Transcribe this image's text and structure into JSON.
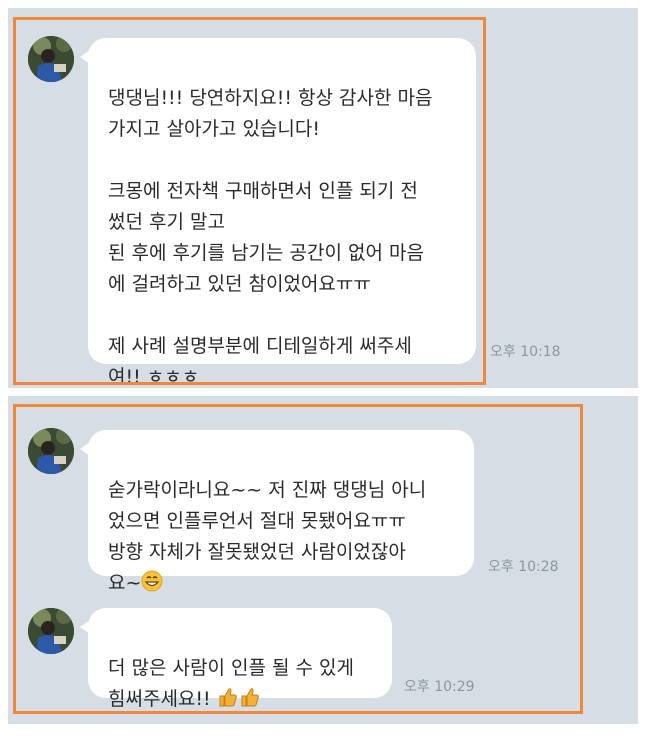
{
  "messages": [
    {
      "text": "댕댕님!!! 당연하지요!! 항상 감사한 마음\n가지고 살아가고 있습니다!\n\n크몽에 전자책 구매하면서 인플 되기 전\n썼던 후기 말고\n된 후에 후기를 남기는 공간이 없어 마음\n에 걸려하고 있던 참이었어요ㅠㅠ\n\n제 사례 설명부분에 디테일하게 써주세\n여!! ㅎㅎㅎ",
      "time": "오후 10:18"
    },
    {
      "text": "숟가락이라니요~~ 저 진짜 댕댕님 아니\n었으면 인플루언서 절대 못됐어요ㅠㅠ\n방향 자체가 잘못됐었던 사람이었잖아\n요~",
      "emoji": "grinning-face",
      "time": "오후 10:28"
    },
    {
      "text": "더 많은 사람이 인플 될 수 있게\n힘써주세요!! ",
      "emoji": "thumbs-up-x2",
      "time": "오후 10:29"
    }
  ],
  "colors": {
    "chat_background": "#d6dde4",
    "bubble": "#ffffff",
    "highlight_border": "#f0883a",
    "timestamp": "#8d96a0"
  }
}
